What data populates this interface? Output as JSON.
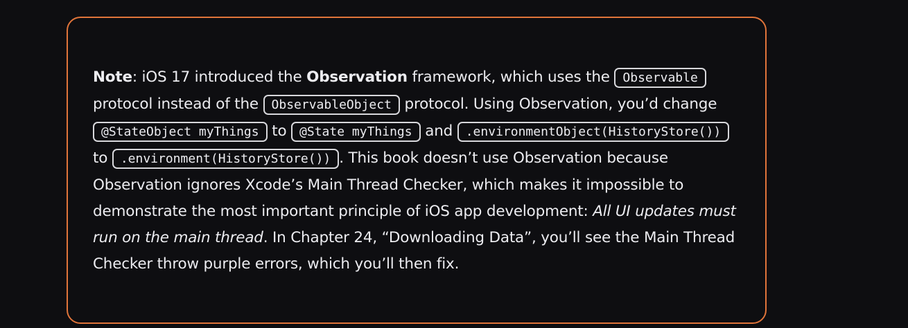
{
  "note": {
    "label": "Note",
    "t1": ": iOS 17 introduced the ",
    "framework_name": "Observation",
    "t2": " framework, which uses the ",
    "code_observable": "Observable",
    "t3": " protocol instead of the ",
    "code_observable_object": "ObservableObject",
    "t4": " protocol. Using Observation, you’d change ",
    "code_state_object": "@StateObject myThings",
    "t5": " to ",
    "code_state": "@State myThings",
    "t6": " and ",
    "code_environment_object": ".environmentObject(HistoryStore())",
    "t7": " to ",
    "code_environment": ".environment(HistoryStore())",
    "t8": ". This book doesn’t use Observation because Observation ignores Xcode’s Main Thread Checker, which makes it impossible to demonstrate the most important principle of iOS app development: ",
    "principle": "All UI updates must run on the main thread",
    "t9": ". In Chapter 24, “Downloading Data”, you’ll see the Main Thread Checker throw purple errors, which you’ll then fix."
  },
  "colors": {
    "background": "#0e0e11",
    "border_accent": "#e0743a",
    "text": "#ececf0"
  }
}
